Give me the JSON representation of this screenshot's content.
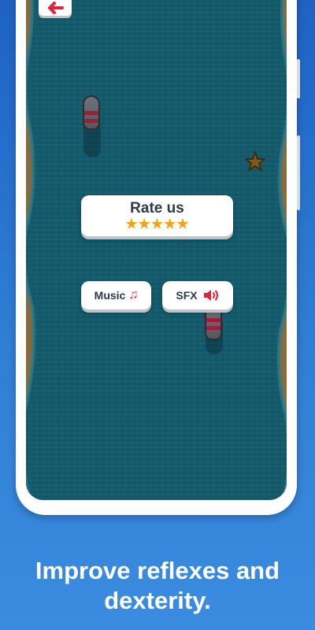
{
  "rate_card": {
    "title": "Rate us",
    "star_count": 5,
    "star_color": "#f5a21b"
  },
  "buttons": {
    "music_label": "Music",
    "music_icon": "music-note-icon",
    "sfx_label": "SFX",
    "sfx_icon": "speaker-icon",
    "back_icon": "back-arrow-icon"
  },
  "caption": {
    "line1": "Improve reflexes and",
    "line2": "dexterity."
  },
  "colors": {
    "background": "#2f7fd6",
    "water": "#135a6c",
    "accent_red": "#e4203c",
    "shore": "#8a6a3a"
  }
}
